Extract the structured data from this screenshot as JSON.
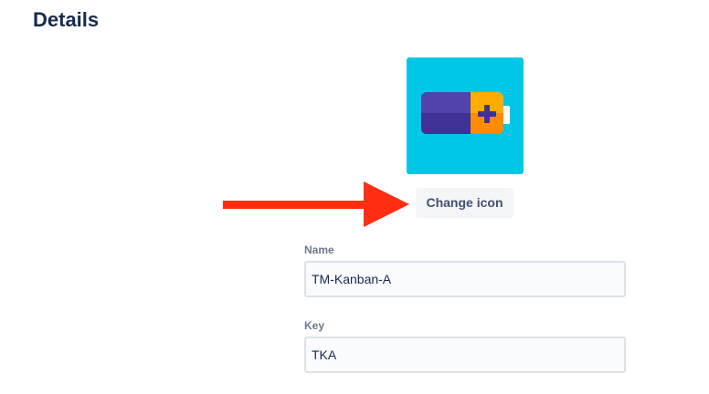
{
  "page": {
    "title": "Details"
  },
  "project_icon": {
    "icon": "battery-plus-icon",
    "background_color": "#00c7e6"
  },
  "change_icon": {
    "label": "Change icon"
  },
  "annotation": {
    "icon": "red-arrow-icon",
    "color": "#ff2d12"
  },
  "form": {
    "name": {
      "label": "Name",
      "value": "TM-Kanban-A"
    },
    "key": {
      "label": "Key",
      "value": "TKA"
    }
  }
}
